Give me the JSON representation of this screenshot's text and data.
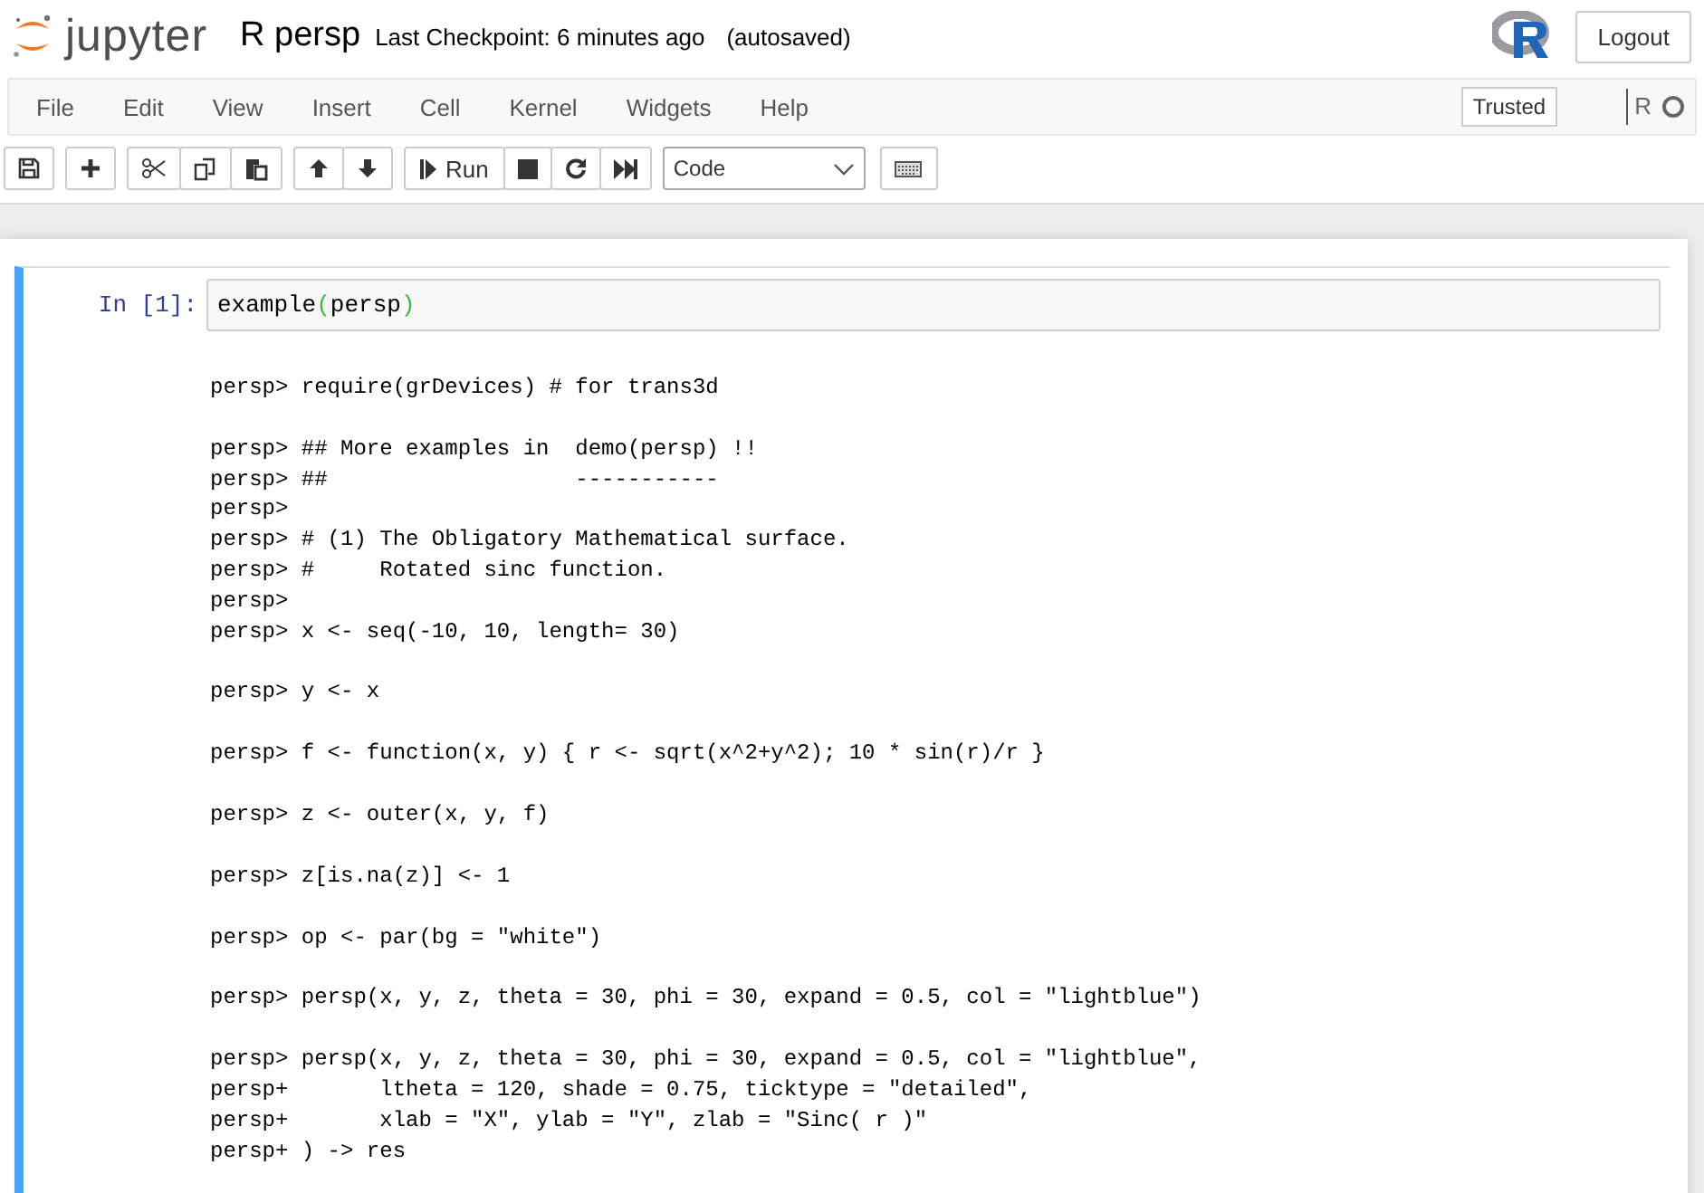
{
  "header": {
    "logo_text": "jupyter",
    "notebook_name": "R persp",
    "checkpoint": "Last Checkpoint: 6 minutes ago",
    "autosave": "(autosaved)",
    "logout": "Logout"
  },
  "menu": [
    "File",
    "Edit",
    "View",
    "Insert",
    "Cell",
    "Kernel",
    "Widgets",
    "Help"
  ],
  "trusted": "Trusted",
  "kernel_name": "R",
  "toolbar": {
    "run": "Run",
    "cell_type": "Code"
  },
  "cell": {
    "prompt": "In [1]:",
    "input": [
      {
        "kind": "name",
        "text": "example"
      },
      {
        "kind": "paren",
        "text": "("
      },
      {
        "kind": "name",
        "text": "persp"
      },
      {
        "kind": "paren",
        "text": ")"
      }
    ],
    "output": [
      [
        "persp> require(grDevices) # for trans3d"
      ],
      [
        "persp> ## More examples in  demo(persp) !!",
        "persp> ##                   -----------",
        "persp> ",
        "persp> # (1) The Obligatory Mathematical surface.",
        "persp> #     Rotated sinc function.",
        "persp> ",
        "persp> x <- seq(-10, 10, length= 30)"
      ],
      [
        "persp> y <- x"
      ],
      [
        "persp> f <- function(x, y) { r <- sqrt(x^2+y^2); 10 * sin(r)/r }"
      ],
      [
        "persp> z <- outer(x, y, f)"
      ],
      [
        "persp> z[is.na(z)] <- 1"
      ],
      [
        "persp> op <- par(bg = \"white\")"
      ],
      [
        "persp> persp(x, y, z, theta = 30, phi = 30, expand = 0.5, col = \"lightblue\")"
      ],
      [
        "persp> persp(x, y, z, theta = 30, phi = 30, expand = 0.5, col = \"lightblue\",",
        "persp+       ltheta = 120, shade = 0.75, ticktype = \"detailed\",",
        "persp+       xlab = \"X\", ylab = \"Y\", zlab = \"Sinc( r )\"",
        "persp+ ) -> res"
      ]
    ]
  }
}
